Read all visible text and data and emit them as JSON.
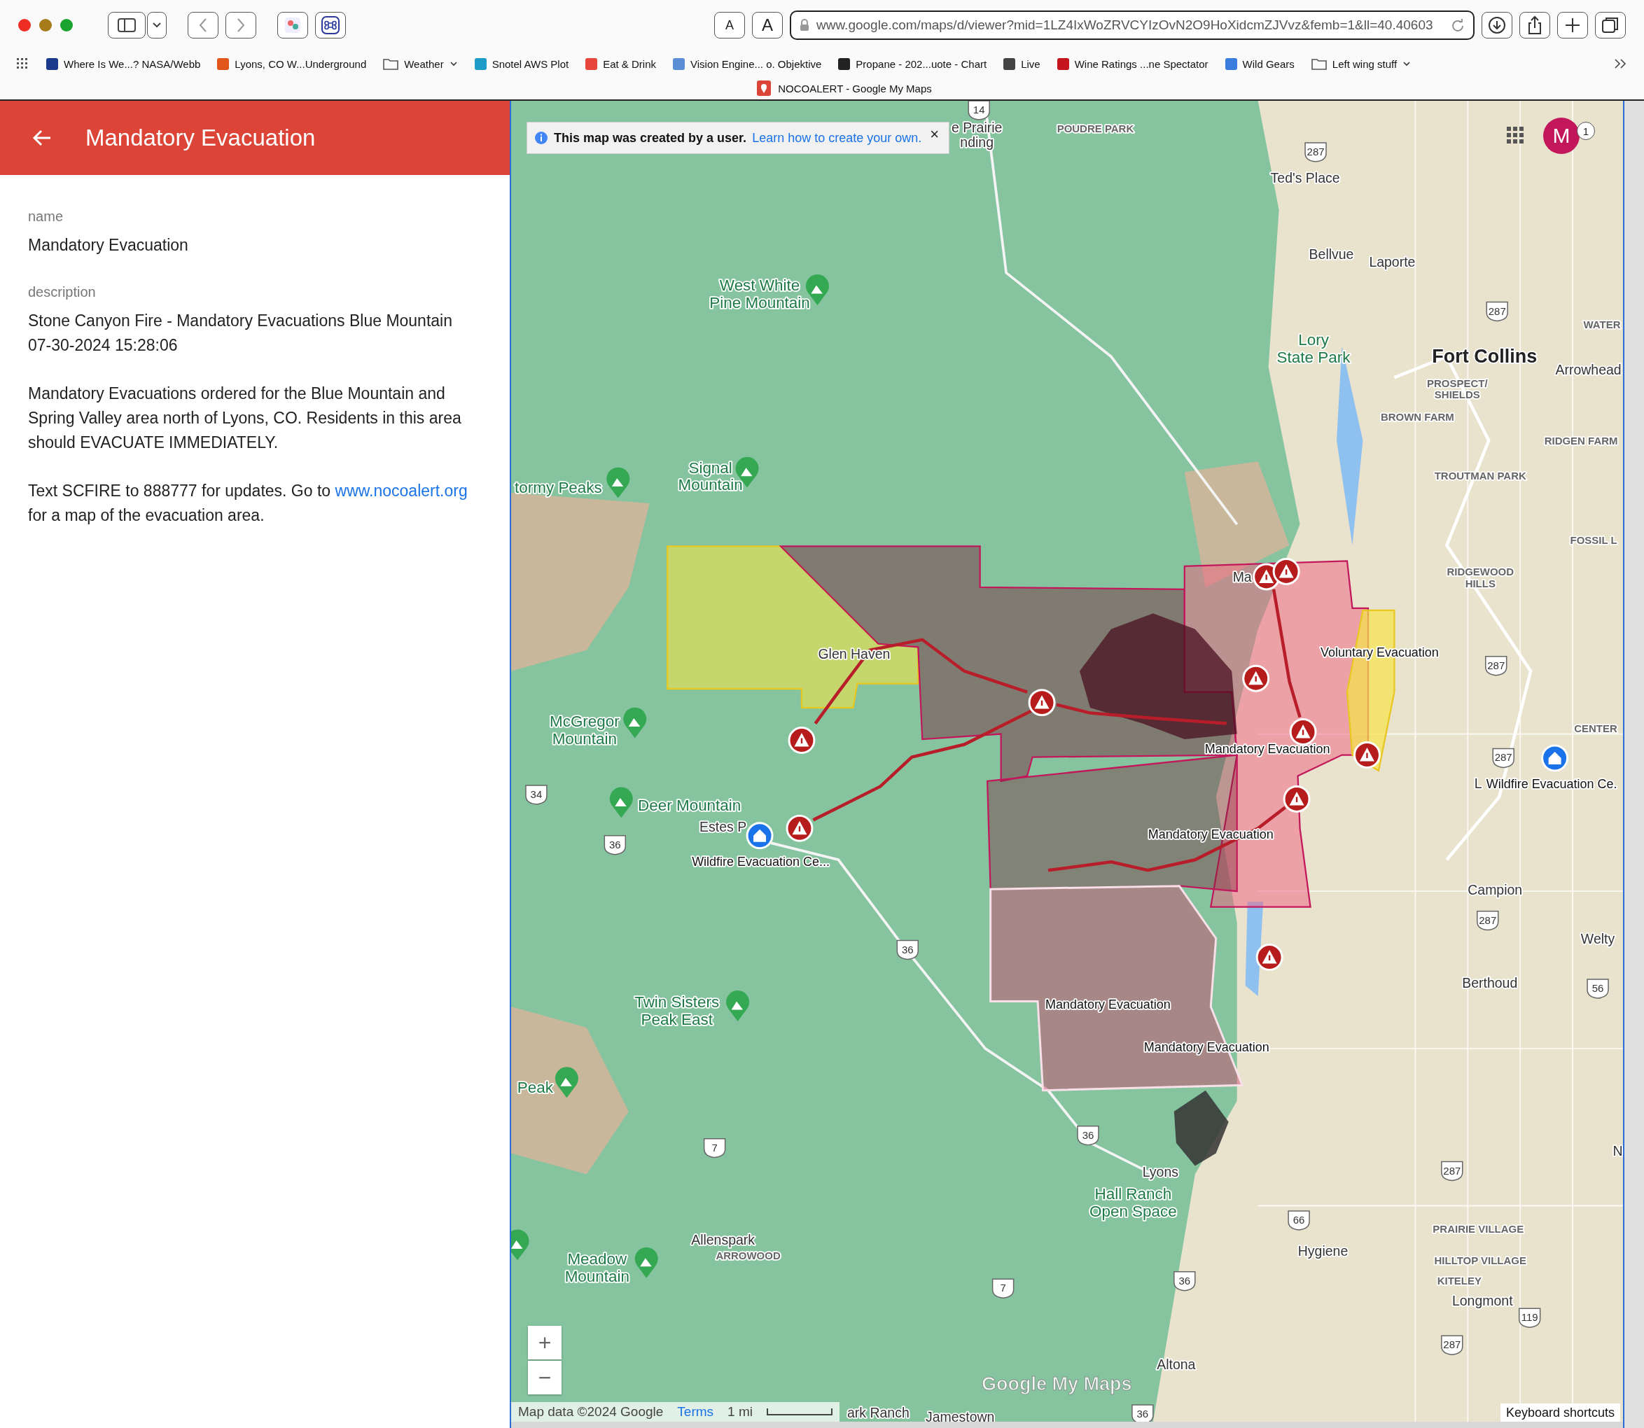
{
  "toolbar": {
    "text_size_buttons": [
      "A",
      "A"
    ],
    "url": "www.google.com/maps/d/viewer?mid=1LZ4IxWoZRVCYIzOvN2O9HoXidcmZJVvz&femb=1&ll=40.40603"
  },
  "bookmarks": [
    {
      "label": "Where Is We...? NASA/Webb",
      "kind": "site",
      "color": "#1b3a8c"
    },
    {
      "label": "Lyons, CO W...Underground",
      "kind": "site",
      "color": "#e0561b"
    },
    {
      "label": "Weather",
      "kind": "folder"
    },
    {
      "label": "Snotel AWS Plot",
      "kind": "site",
      "color": "#1e9bc7"
    },
    {
      "label": "Eat & Drink",
      "kind": "site",
      "color": "#e8453c"
    },
    {
      "label": "Vision Engine... o. Objektive",
      "kind": "site",
      "color": "#5a8fd6"
    },
    {
      "label": "Propane - 202...uote - Chart",
      "kind": "site",
      "color": "#222222"
    },
    {
      "label": "Live",
      "kind": "site",
      "color": "#444444"
    },
    {
      "label": "Wine Ratings ...ne Spectator",
      "kind": "site",
      "color": "#c4161c"
    },
    {
      "label": "Wild Gears",
      "kind": "site",
      "color": "#3b7ddd"
    },
    {
      "label": "Left wing stuff",
      "kind": "folder"
    }
  ],
  "tab": {
    "title": "NOCOALERT - Google My Maps"
  },
  "sidebar": {
    "title": "Mandatory Evacuation",
    "fields": [
      {
        "label": "name",
        "paragraphs": [
          {
            "text": "Mandatory Evacuation"
          }
        ]
      },
      {
        "label": "description",
        "paragraphs": [
          {
            "text": "Stone Canyon Fire - Mandatory Evacuations Blue Mountain\n07-30-2024 15:28:06"
          },
          {
            "text": "Mandatory Evacuations ordered for the Blue Mountain and Spring Valley area north of Lyons, CO. Residents in this area should EVACUATE IMMEDIATELY."
          },
          {
            "text": "Text SCFIRE to 888777 for updates. Go to",
            "link": "www.nocoalert.org",
            "after": "for a map of the evacuation area."
          }
        ]
      }
    ]
  },
  "map": {
    "notice": {
      "text": "This map was created by a user.",
      "link": "Learn how to create your own.",
      "close": "×"
    },
    "avatar": "M",
    "avatar_badge": "1",
    "zoom": [
      "+",
      "−"
    ],
    "labels": [
      {
        "lines": [
          "Ted's Place"
        ],
        "kind": "town"
      },
      {
        "lines": [
          "Bellvue"
        ],
        "kind": "town"
      },
      {
        "lines": [
          "Laporte"
        ],
        "kind": "town"
      },
      {
        "lines": [
          "POUDRE PARK"
        ],
        "kind": "district"
      },
      {
        "lines": [
          "e Prairie",
          "nding"
        ],
        "kind": "town"
      },
      {
        "lines": [
          "West White",
          "Pine Mountain"
        ],
        "kind": "park"
      },
      {
        "lines": [
          "Lory",
          "State Park"
        ],
        "kind": "park"
      },
      {
        "lines": [
          "Fort Collins"
        ],
        "kind": "city"
      },
      {
        "lines": [
          "WATER"
        ],
        "kind": "district"
      },
      {
        "lines": [
          "Arrowhead"
        ],
        "kind": "town"
      },
      {
        "lines": [
          "PROSPECT/",
          "SHIELDS"
        ],
        "kind": "district"
      },
      {
        "lines": [
          "BROWN FARM"
        ],
        "kind": "district"
      },
      {
        "lines": [
          "RIDGEN FARM"
        ],
        "kind": "district"
      },
      {
        "lines": [
          "TROUTMAN PARK"
        ],
        "kind": "district"
      },
      {
        "lines": [
          "FOSSIL L"
        ],
        "kind": "district"
      },
      {
        "lines": [
          "RIDGEWOOD",
          "HILLS"
        ],
        "kind": "district"
      },
      {
        "lines": [
          "Signal",
          "Mountain"
        ],
        "kind": "park"
      },
      {
        "lines": [
          "tormy Peaks"
        ],
        "kind": "park"
      },
      {
        "lines": [
          "Ma"
        ],
        "kind": "town"
      },
      {
        "lines": [
          "Glen Haven"
        ],
        "kind": "town"
      },
      {
        "lines": [
          "Voluntary Evacuation"
        ],
        "kind": "zone"
      },
      {
        "lines": [
          "McGregor",
          "Mountain"
        ],
        "kind": "park"
      },
      {
        "lines": [
          "CENTER"
        ],
        "kind": "district"
      },
      {
        "lines": [
          "Mandatory Evacuation"
        ],
        "kind": "zone"
      },
      {
        "lines": [
          "L"
        ],
        "kind": "town"
      },
      {
        "lines": [
          "Wildfire Evacuation Ce."
        ],
        "kind": "zone"
      },
      {
        "lines": [
          "Deer Mountain"
        ],
        "kind": "park"
      },
      {
        "lines": [
          "Estes P"
        ],
        "kind": "town"
      },
      {
        "lines": [
          "Mandatory Evacuation"
        ],
        "kind": "zone"
      },
      {
        "lines": [
          "Wildfire Evacuation Ce..."
        ],
        "kind": "zone"
      },
      {
        "lines": [
          "Campion"
        ],
        "kind": "town"
      },
      {
        "lines": [
          "Welty"
        ],
        "kind": "town"
      },
      {
        "lines": [
          "Berthoud"
        ],
        "kind": "town"
      },
      {
        "lines": [
          "Twin Sisters",
          "Peak East"
        ],
        "kind": "park"
      },
      {
        "lines": [
          "Mandatory Evacuation"
        ],
        "kind": "zone"
      },
      {
        "lines": [
          "Mandatory Evacuation"
        ],
        "kind": "zone"
      },
      {
        "lines": [
          "Peak"
        ],
        "kind": "park"
      },
      {
        "lines": [
          "N"
        ],
        "kind": "town"
      },
      {
        "lines": [
          "Lyons"
        ],
        "kind": "town"
      },
      {
        "lines": [
          "Hall Ranch",
          "Open Space"
        ],
        "kind": "park"
      },
      {
        "lines": [
          "PRAIRIE VILLAGE"
        ],
        "kind": "district"
      },
      {
        "lines": [
          "Allenspark"
        ],
        "kind": "town"
      },
      {
        "lines": [
          "Meadow",
          "Mountain"
        ],
        "kind": "park"
      },
      {
        "lines": [
          "ARROWOOD"
        ],
        "kind": "district"
      },
      {
        "lines": [
          "Hygiene"
        ],
        "kind": "town"
      },
      {
        "lines": [
          "HILLTOP VILLAGE"
        ],
        "kind": "district"
      },
      {
        "lines": [
          "KITELEY"
        ],
        "kind": "district"
      },
      {
        "lines": [
          "Longmont"
        ],
        "kind": "town"
      },
      {
        "lines": [
          "Altona"
        ],
        "kind": "town"
      },
      {
        "lines": [
          "ark Ranch"
        ],
        "kind": "town"
      },
      {
        "lines": [
          "Jamestown"
        ],
        "kind": "town"
      }
    ],
    "routes": [
      "14",
      "287",
      "287",
      "287",
      "287",
      "287",
      "287",
      "287",
      "34",
      "36",
      "36",
      "36",
      "36",
      "36",
      "7",
      "7",
      "66",
      "56",
      "119"
    ],
    "logo": "Google My Maps",
    "attribution": "Map data ©2024 Google",
    "terms": "Terms",
    "scale": "1 mi",
    "shortcuts": "Keyboard shortcuts"
  }
}
